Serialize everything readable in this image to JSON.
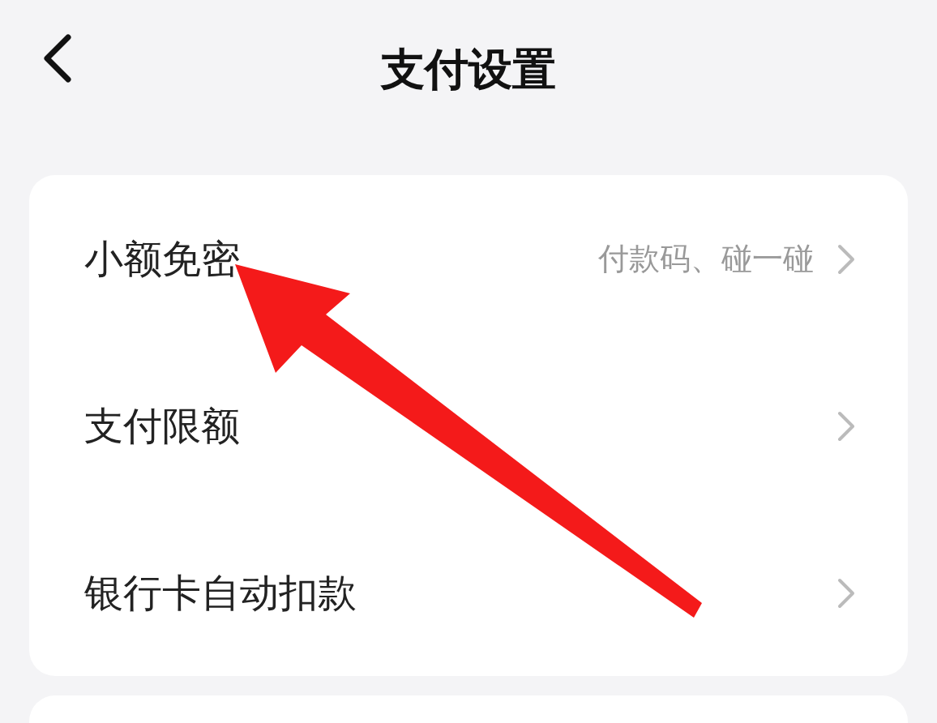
{
  "header": {
    "title": "支付设置"
  },
  "settings": [
    {
      "label": "小额免密",
      "value": "付款码、碰一碰"
    },
    {
      "label": "支付限额"
    },
    {
      "label": "银行卡自动扣款"
    }
  ],
  "annotation": {
    "kind": "arrow"
  }
}
